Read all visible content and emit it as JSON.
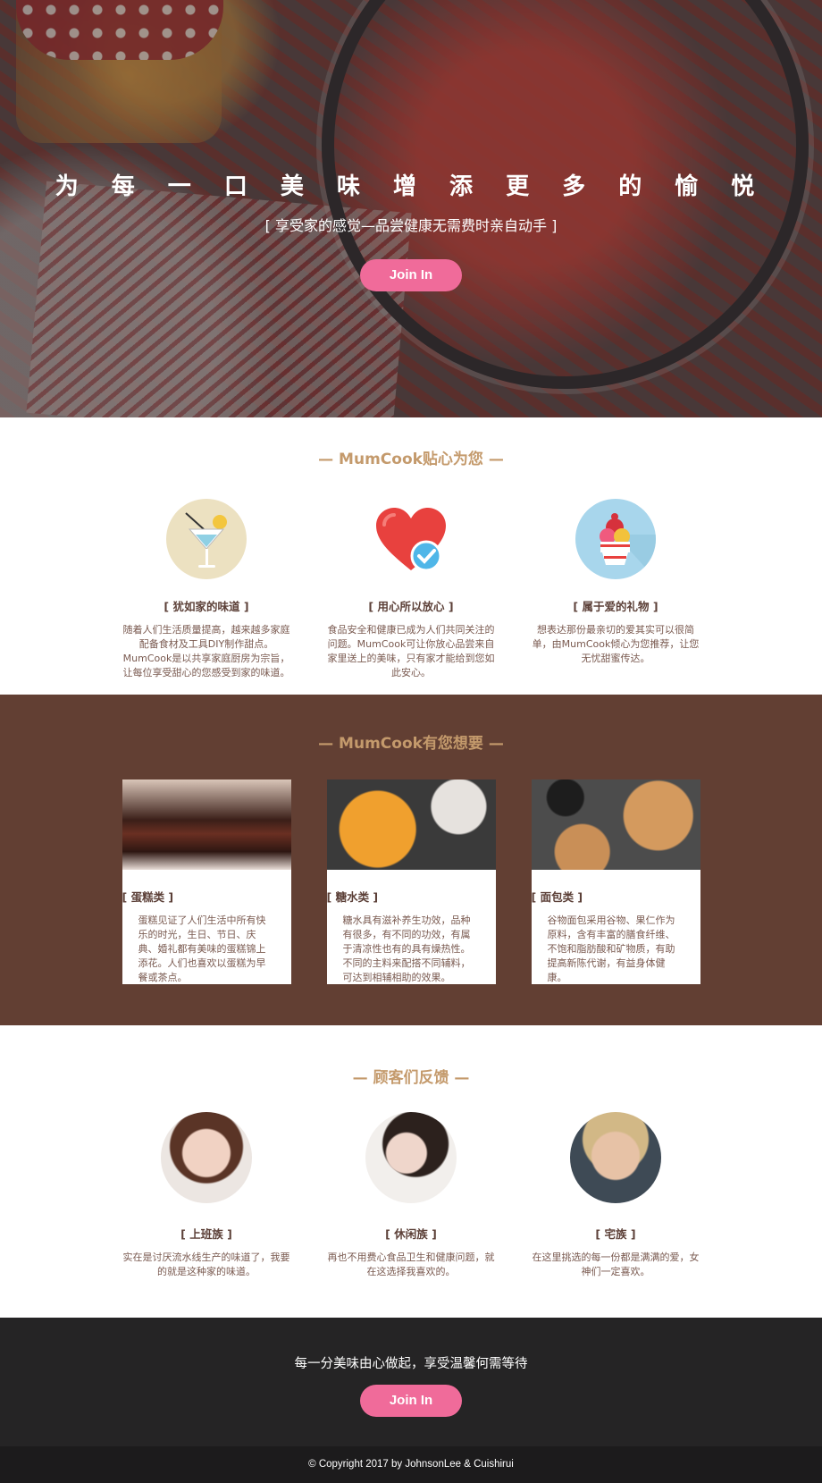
{
  "hero": {
    "title": "为 每 一 口 美 味 增 添 更 多 的 愉 悦",
    "subtitle": "[ 享受家的感觉—品尝健康无需费时亲自动手 ]",
    "join_label": "Join In"
  },
  "features": {
    "heading": "— MumCook贴心为您 —",
    "items": [
      {
        "icon": "cocktail-icon",
        "title": "[ 犹如家的味道 ]",
        "desc": "随着人们生活质量提高，越来越多家庭配备食材及工具DIY制作甜点。MumCook是以共享家庭厨房为宗旨，让每位享受甜心的您感受到家的味道。"
      },
      {
        "icon": "heart-check-icon",
        "title": "[ 用心所以放心 ]",
        "desc": "食品安全和健康已成为人们共同关注的问题。MumCook可让你放心品尝来自家里送上的美味，只有家才能给到您如此安心。"
      },
      {
        "icon": "cupcake-gift-icon",
        "title": "[ 属于爱的礼物 ]",
        "desc": "想表达那份最亲切的爱其实可以很简单，由MumCook倾心为您推荐，让您无忧甜蜜传达。"
      }
    ]
  },
  "products": {
    "heading": "— MumCook有您想要 —",
    "items": [
      {
        "image": "cake-photo",
        "title": "[ 蛋糕类 ]",
        "desc": "蛋糕见证了人们生活中所有快乐的时光，生日、节日、庆典、婚礼都有美味的蛋糕锦上添花。人们也喜欢以蛋糕为早餐或茶点。"
      },
      {
        "image": "sweet-soup-photo",
        "title": "[ 糖水类 ]",
        "desc": "糖水具有滋补养生功效，品种有很多，有不同的功效，有属于清凉性也有的具有燥热性。不同的主料来配搭不同辅料，可达到相辅相助的效果。"
      },
      {
        "image": "bread-photo",
        "title": "[ 面包类 ]",
        "desc": "谷物面包采用谷物、果仁作为原料，含有丰富的膳食纤维、不饱和脂肪酸和矿物质，有助提高新陈代谢，有益身体健康。"
      }
    ]
  },
  "feedback": {
    "heading": "— 顾客们反馈 —",
    "items": [
      {
        "title": "[ 上班族 ]",
        "desc": "实在是讨厌流水线生产的味道了，我要的就是这种家的味道。"
      },
      {
        "title": "[ 休闲族 ]",
        "desc": "再也不用费心食品卫生和健康问题，就在这选择我喜欢的。"
      },
      {
        "title": "[ 宅族 ]",
        "desc": "在这里挑选的每一份都是满满的爱，女神们一定喜欢。"
      }
    ]
  },
  "cta": {
    "text": "每一分美味由心做起，享受温馨何需等待",
    "join_label": "Join In"
  },
  "footer": {
    "copyright": "© Copyright 2017 by JohnsonLee & Cuishirui"
  },
  "colors": {
    "accent_pink": "#f06b9a",
    "heading_gold": "#c49a6c",
    "products_bg": "#623f33",
    "cta_bg": "#252425",
    "footer_bg": "#1c1b1c"
  }
}
